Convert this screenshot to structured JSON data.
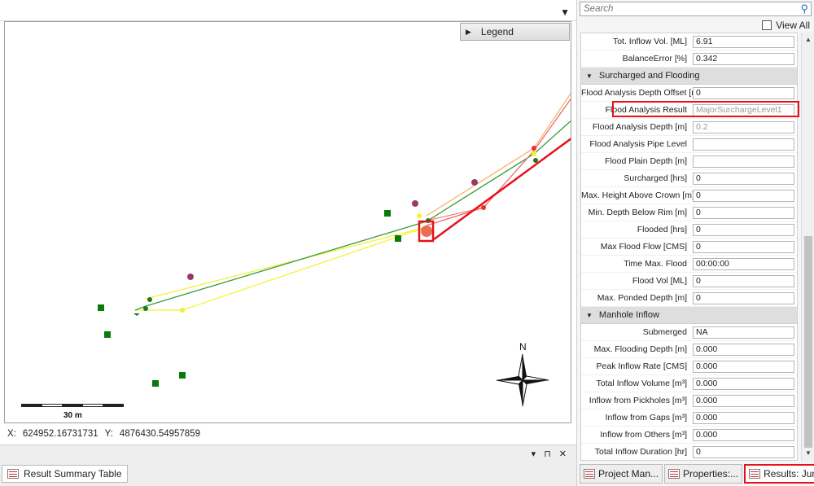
{
  "map": {
    "legend_label": "Legend",
    "scale_label": "30 m",
    "north_label": "N",
    "coords": {
      "x_label": "X:",
      "x_value": "624952.16731731",
      "y_label": "Y:",
      "y_value": "4876430.54957859"
    }
  },
  "bottom_left": {
    "tab_label": "Result Summary Table",
    "dock_menu": "▾",
    "dock_pin": "⊓",
    "dock_close": "✕"
  },
  "panel": {
    "search_placeholder": "Search",
    "view_all_label": "View All",
    "rows_top": [
      {
        "label": "Tot. Inflow Vol. [ML]",
        "value": "6.91"
      },
      {
        "label": "BalanceError [%]",
        "value": "0.342"
      }
    ],
    "category_surcharged": "Surcharged and Flooding",
    "rows_surcharged": [
      {
        "label": "Flood Analysis Depth Offset [m]",
        "value": "0"
      },
      {
        "label": "Flood Analysis Result",
        "value": "MajorSurchargeLevel1",
        "dim": true
      },
      {
        "label": "Flood Analysis Depth [m]",
        "value": "0.2",
        "dim": true
      },
      {
        "label": "Flood Analysis Pipe Level",
        "value": ""
      },
      {
        "label": "Flood Plain Depth [m]",
        "value": ""
      },
      {
        "label": "Surcharged [hrs]",
        "value": "0"
      },
      {
        "label": "Max. Height Above Crown [m]",
        "value": "0"
      },
      {
        "label": "Min. Depth Below Rim [m]",
        "value": "0"
      },
      {
        "label": "Flooded [hrs]",
        "value": "0"
      },
      {
        "label": "Max Flood Flow [CMS]",
        "value": "0"
      },
      {
        "label": "Time Max. Flood",
        "value": "00:00:00"
      },
      {
        "label": "Flood Vol [ML]",
        "value": "0"
      },
      {
        "label": "Max. Ponded Depth [m]",
        "value": "0"
      }
    ],
    "category_inflow": "Manhole Inflow",
    "rows_inflow": [
      {
        "label": "Submerged",
        "value": "NA"
      },
      {
        "label": "Max. Flooding Depth [m]",
        "value": "0.000"
      },
      {
        "label": "Peak Inflow Rate [CMS]",
        "value": "0.000"
      },
      {
        "label": "Total Inflow Volume [m³]",
        "value": "0.000"
      },
      {
        "label": "Inflow from Pickholes [m³]",
        "value": "0.000"
      },
      {
        "label": "Inflow from Gaps [m³]",
        "value": "0.000"
      },
      {
        "label": "Inflow from Others [m³]",
        "value": "0.000"
      },
      {
        "label": "Total Inflow Duration [hr]",
        "value": "0"
      }
    ],
    "tabs": [
      {
        "label": "Project Man...",
        "icon": "project-manager-icon"
      },
      {
        "label": "Properties:...",
        "icon": "properties-icon"
      },
      {
        "label": "Results: Junc...",
        "icon": "results-icon"
      }
    ]
  },
  "colors": {
    "highlight": "#e8101a",
    "conduit_green": "#3a9a3a",
    "conduit_yellow": "#f2f22a",
    "conduit_orange": "#f5b76a",
    "conduit_red": "#f06a6a"
  }
}
